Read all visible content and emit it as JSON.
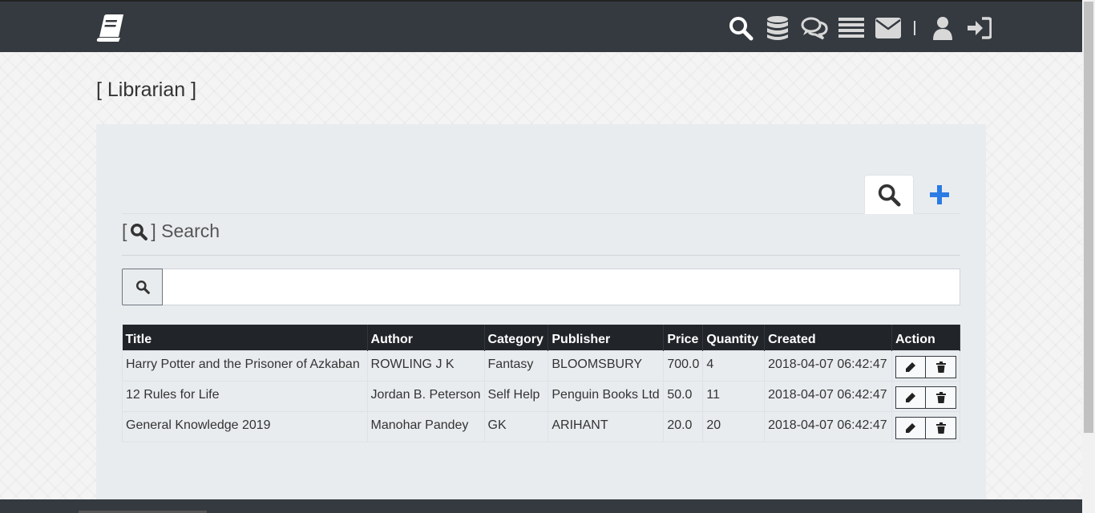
{
  "colors": {
    "navbar": "#343a40",
    "accent_blue": "#2a7be4",
    "table_header": "#212529",
    "panel": "#e9ecef"
  },
  "navbar": {
    "icons": [
      "book-logo-icon",
      "search-icon",
      "database-icon",
      "comments-icon",
      "list-icon",
      "envelope-icon",
      "user-icon",
      "sign-in-icon"
    ]
  },
  "page": {
    "heading": "[ Librarian ]"
  },
  "search_section": {
    "open_bracket": "[",
    "label": "] Search",
    "input_value": "",
    "input_placeholder": ""
  },
  "table": {
    "headers": [
      "Title",
      "Author",
      "Category",
      "Publisher",
      "Price",
      "Quantity",
      "Created",
      "Action"
    ],
    "rows": [
      [
        "Harry Potter and the Prisoner of Azkaban",
        "ROWLING J K",
        "Fantasy",
        "BLOOMSBURY",
        "700.0",
        "4",
        "2018-04-07 06:42:47"
      ],
      [
        "12 Rules for Life",
        "Jordan B. Peterson",
        "Self Help",
        "Penguin Books Ltd",
        "50.0",
        "11",
        "2018-04-07 06:42:47"
      ],
      [
        "General Knowledge 2019",
        "Manohar Pandey",
        "GK",
        "ARIHANT",
        "20.0",
        "20",
        "2018-04-07 06:42:47"
      ]
    ],
    "row_actions": [
      "pencil-icon",
      "trash-icon"
    ]
  }
}
